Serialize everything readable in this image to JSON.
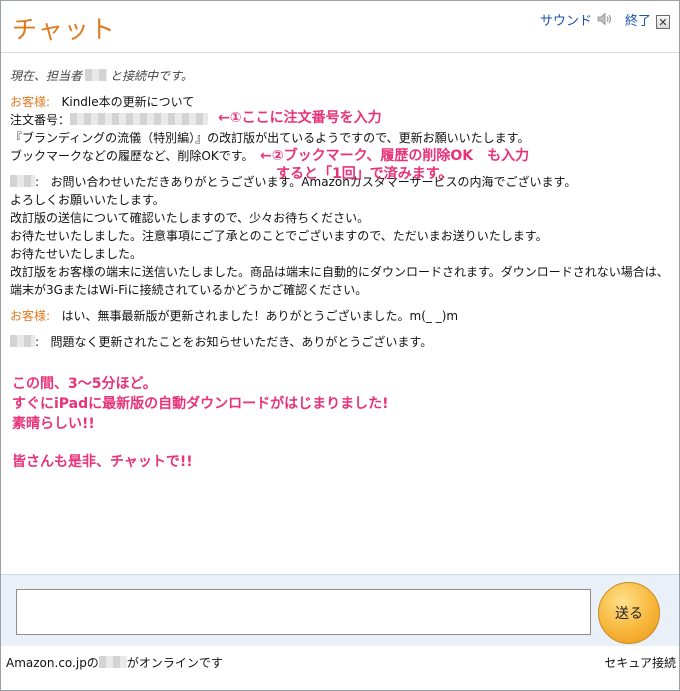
{
  "header": {
    "title": "チャット",
    "sound_label": "サウンド",
    "sound_icon": "speaker-icon",
    "end_label": "終了",
    "close_icon": "close-icon"
  },
  "log": {
    "status_prefix": "現在、担当者",
    "status_suffix": "と接続中です。",
    "customer_label": "お客様:",
    "customer_msg1": [
      "Kindle本の更新について",
      "注文番号：",
      "『ブランディングの流儀（特別編）』の改訂版が出ているようですので、更新お願いいたします。",
      "ブックマークなどの履歴など、削除OKです。"
    ],
    "agent_msg1": [
      "お問い合わせいただきありがとうございます。Amazonカスタマーサービスの内海でございます。",
      "よろしくお願いいたします。",
      "改訂版の送信について確認いたしますので、少々お待ちください。",
      "お待たせいたしました。注意事項にご了承とのことでございますので、ただいまお送りいたします。",
      "お待たせいたしました。",
      "改訂版をお客様の端末に送信いたしました。商品は端末に自動的にダウンロードされます。ダウンロードされない場合は、",
      "端末が3GまたはWi-Fiに接続されているかどうかご確認ください。"
    ],
    "customer_msg2": "はい、無事最新版が更新されました！ありがとうございました。m(_ _)m",
    "agent_msg2": "問題なく更新されたことをお知らせいただき、ありがとうございます。"
  },
  "annotations": {
    "note1": "←①ここに注文番号を入力",
    "note2_line1": "←②ブックマーク、履歴の削除OK　も入力",
    "note2_line2": "すると「1回」で済みます。",
    "commentary": [
      "この間、3〜5分ほど。",
      "すぐにiPadに最新版の自動ダウンロードがはじまりました!",
      "素晴らしい!!",
      "",
      "皆さんも是非、チャットで!!"
    ]
  },
  "input": {
    "value": "",
    "send_label": "送る"
  },
  "footer": {
    "online_prefix": "Amazon.co.jpの",
    "online_suffix": "がオンラインです",
    "secure_label": "セキュア接続"
  },
  "colors": {
    "title": "#e07a20",
    "customer_label": "#e07a20",
    "annotation": "#e8337a",
    "link": "#1a55a8",
    "input_bg": "#e9f0f8",
    "send_button": "#f7b63a"
  }
}
